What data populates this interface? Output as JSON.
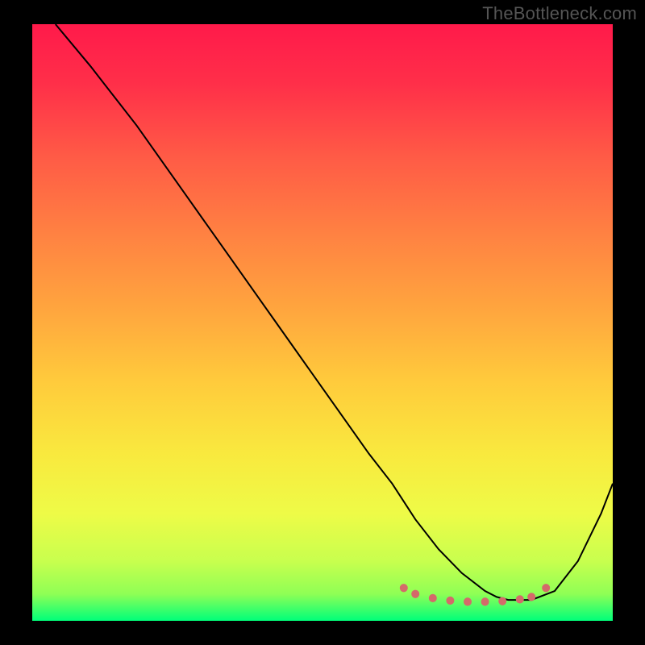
{
  "watermark": "TheBottleneck.com",
  "gradient_stops": [
    {
      "offset": 0.0,
      "color": "#ff1a4a"
    },
    {
      "offset": 0.1,
      "color": "#ff2f49"
    },
    {
      "offset": 0.22,
      "color": "#ff5a46"
    },
    {
      "offset": 0.35,
      "color": "#ff8142"
    },
    {
      "offset": 0.48,
      "color": "#ffa63e"
    },
    {
      "offset": 0.6,
      "color": "#ffcb3c"
    },
    {
      "offset": 0.72,
      "color": "#f9e93e"
    },
    {
      "offset": 0.82,
      "color": "#eefb47"
    },
    {
      "offset": 0.9,
      "color": "#c8ff4e"
    },
    {
      "offset": 0.955,
      "color": "#8fff55"
    },
    {
      "offset": 0.985,
      "color": "#2fff6e"
    },
    {
      "offset": 1.0,
      "color": "#00ff7a"
    }
  ],
  "chart_data": {
    "type": "line",
    "title": "",
    "xlabel": "",
    "ylabel": "",
    "xlim": [
      0,
      100
    ],
    "ylim": [
      0,
      100
    ],
    "grid": false,
    "legend": false,
    "annotations": [],
    "series": [
      {
        "name": "curve",
        "x": [
          4,
          10,
          18,
          26,
          34,
          42,
          50,
          58,
          62,
          66,
          70,
          74,
          78,
          80,
          82,
          86,
          90,
          94,
          98,
          100
        ],
        "y": [
          100,
          93,
          83,
          72,
          61,
          50,
          39,
          28,
          23,
          17,
          12,
          8,
          5,
          4,
          3.5,
          3.5,
          5,
          10,
          18,
          23
        ],
        "color": "#000000",
        "linewidth": 2
      }
    ],
    "markers": {
      "name": "bottom-dotted",
      "color": "#d46a6a",
      "points": [
        {
          "x": 64,
          "y": 5.5
        },
        {
          "x": 66,
          "y": 4.5
        },
        {
          "x": 69,
          "y": 3.8
        },
        {
          "x": 72,
          "y": 3.4
        },
        {
          "x": 75,
          "y": 3.2
        },
        {
          "x": 78,
          "y": 3.2
        },
        {
          "x": 81,
          "y": 3.3
        },
        {
          "x": 84,
          "y": 3.6
        },
        {
          "x": 86,
          "y": 4.0
        },
        {
          "x": 88.5,
          "y": 5.5
        }
      ],
      "radius": 5
    }
  }
}
